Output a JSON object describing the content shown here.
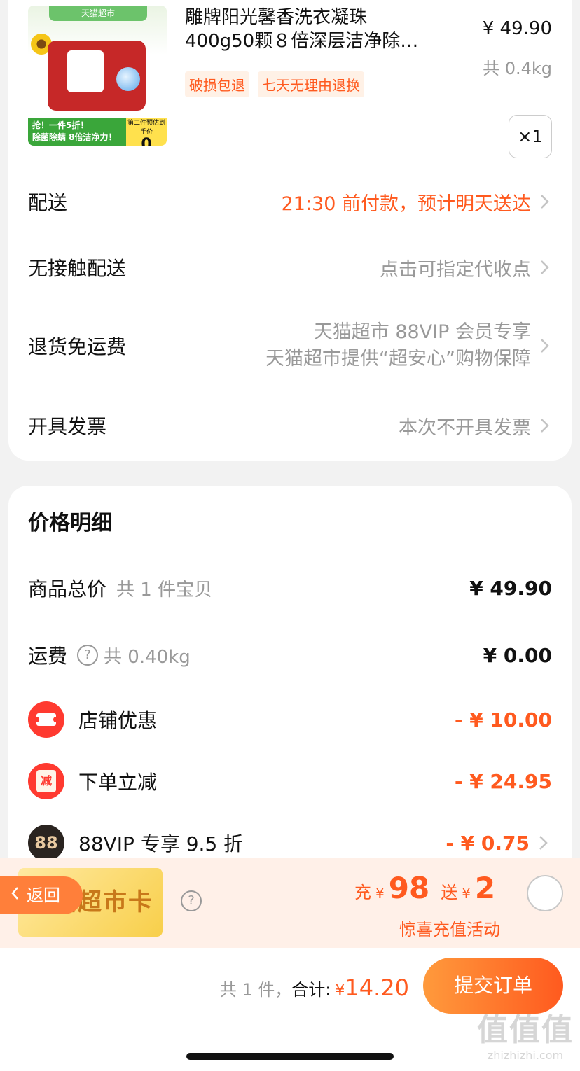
{
  "product": {
    "image_texts": {
      "header": "天猫超市",
      "banner_line1": "抢！一件5折！",
      "banner_line2": "除菌除螨 8倍洁净力！",
      "price_tag_note": "第二件预估到手价",
      "price_tag_value": "0"
    },
    "title_line1": "雕牌阳光馨香洗衣凝珠",
    "title_line2": "400g50颗８倍深层洁净除…",
    "price": "¥ 49.90",
    "weight": "共 0.4kg",
    "tags": [
      "破损包退",
      "七天无理由退换"
    ],
    "quantity": "×1"
  },
  "delivery": {
    "rows": [
      {
        "label": "配送",
        "value": "21:30 前付款，预计明天送达"
      },
      {
        "label": "无接触配送",
        "value": "点击可指定代收点"
      },
      {
        "label": "退货免运费",
        "value_line1": "天猫超市 88VIP 会员专享",
        "value_line2": "天猫超市提供“超安心”购物保障"
      },
      {
        "label": "开具发票",
        "value": "本次不开具发票"
      }
    ]
  },
  "price_details": {
    "title": "价格明细",
    "goods_total": {
      "label": "商品总价",
      "sub": "共 1 件宝贝",
      "amount": "¥ 49.90"
    },
    "shipping": {
      "label": "运费",
      "help": "?",
      "sub": "共 0.40kg",
      "amount": "¥ 0.00"
    },
    "store_discount": {
      "label": "店铺优惠",
      "amount": "- ¥ 10.00"
    },
    "order_discount": {
      "label": "下单立减",
      "icon_text": "减",
      "amount": "- ¥ 24.95"
    },
    "vip_discount": {
      "label": "88VIP 专享 9.5 折",
      "icon_text": "88",
      "amount": "- ¥ 0.75"
    }
  },
  "promo": {
    "card_text": "天猫超市卡",
    "help": "?",
    "back_label": "返回",
    "recharge_prefix": "充",
    "recharge_yen": "¥",
    "recharge_amount": "98",
    "gift_prefix": "送",
    "gift_yen": "¥",
    "gift_amount": "2",
    "subtitle": "惊喜充值活动"
  },
  "checkout": {
    "count": "共 1 件，",
    "total_label": "合计:",
    "yen": "¥",
    "total_amount": "14.20",
    "submit_label": "提交订单"
  },
  "watermark": {
    "logo": "值值值",
    "url": "zhizhizhi.com"
  },
  "colors": {
    "accent": "#ff5a1f",
    "submit_start": "#ff9a3c",
    "background": "#f2f2f2"
  }
}
